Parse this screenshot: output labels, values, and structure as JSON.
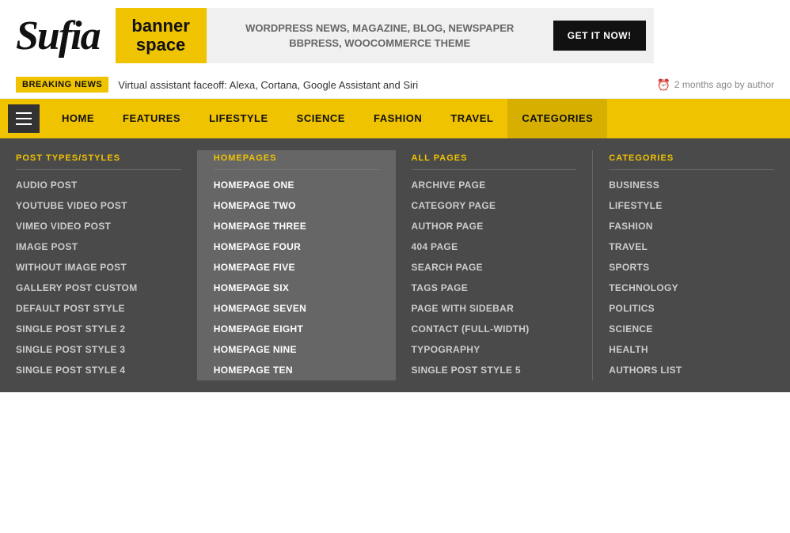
{
  "logo": {
    "text": "Sufia"
  },
  "banner": {
    "label_line1": "banner",
    "label_line2": "space",
    "text": "WORDPRESS NEWS, MAGAZINE, BLOG, NEWSPAPER\nBBPRESS, WOOCOMMERCE THEME",
    "button": "GET IT NOW!"
  },
  "breaking_news": {
    "label": "BREAKING NEWS",
    "text": "Virtual assistant faceoff: Alexa, Cortana, Google Assistant and Siri",
    "time": "2 months ago by author"
  },
  "nav": {
    "items": [
      {
        "id": "home",
        "label": "HOME"
      },
      {
        "id": "features",
        "label": "FEATURES"
      },
      {
        "id": "lifestyle",
        "label": "LIFESTYLE"
      },
      {
        "id": "science",
        "label": "SCIENCE"
      },
      {
        "id": "fashion",
        "label": "FASHION"
      },
      {
        "id": "travel",
        "label": "TRAVEL"
      },
      {
        "id": "categories",
        "label": "CATEGORIES",
        "active": true
      }
    ]
  },
  "mega_menu": {
    "columns": [
      {
        "id": "post-types",
        "header": "POST TYPES/STYLES",
        "items": [
          {
            "label": "AUDIO POST"
          },
          {
            "label": "YOUTUBE VIDEO POST"
          },
          {
            "label": "VIMEO VIDEO POST"
          },
          {
            "label": "IMAGE POST"
          },
          {
            "label": "WITHOUT IMAGE POST"
          },
          {
            "label": "GALLERY POST CUSTOM"
          },
          {
            "label": "DEFAULT POST STYLE"
          },
          {
            "label": "SINGLE POST STYLE 2"
          },
          {
            "label": "SINGLE POST STYLE 3"
          },
          {
            "label": "SINGLE POST STYLE 4"
          }
        ]
      },
      {
        "id": "homepages",
        "header": "HOMEPAGES",
        "highlighted": true,
        "items": [
          {
            "label": "HOMEPAGE ONE"
          },
          {
            "label": "HOMEPAGE TWO"
          },
          {
            "label": "HOMEPAGE THREE"
          },
          {
            "label": "HOMEPAGE FOUR"
          },
          {
            "label": "HOMEPAGE FIVE"
          },
          {
            "label": "HOMEPAGE SIX"
          },
          {
            "label": "HOMEPAGE SEVEN"
          },
          {
            "label": "HOMEPAGE EIGHT"
          },
          {
            "label": "HOMEPAGE NINE"
          },
          {
            "label": "HOMEPAGE TEN"
          }
        ]
      },
      {
        "id": "all-pages",
        "header": "ALL PAGES",
        "items": [
          {
            "label": "ARCHIVE PAGE"
          },
          {
            "label": "CATEGORY PAGE"
          },
          {
            "label": "AUTHOR PAGE"
          },
          {
            "label": "404 PAGE"
          },
          {
            "label": "SEARCH PAGE"
          },
          {
            "label": "TAGS PAGE"
          },
          {
            "label": "PAGE WITH SIDEBAR"
          },
          {
            "label": "CONTACT (FULL-WIDTH)"
          },
          {
            "label": "TYPOGRAPHY"
          },
          {
            "label": "SINGLE POST STYLE 5"
          }
        ]
      },
      {
        "id": "categories",
        "header": "CATEGORIES",
        "items": [
          {
            "label": "BUSINESS"
          },
          {
            "label": "LIFESTYLE"
          },
          {
            "label": "FASHION"
          },
          {
            "label": "TRAVEL"
          },
          {
            "label": "SPORTS"
          },
          {
            "label": "TECHNOLOGY"
          },
          {
            "label": "POLITICS"
          },
          {
            "label": "SCIENCE"
          },
          {
            "label": "HEALTH"
          },
          {
            "label": "AUTHORS LIST"
          }
        ]
      }
    ]
  }
}
